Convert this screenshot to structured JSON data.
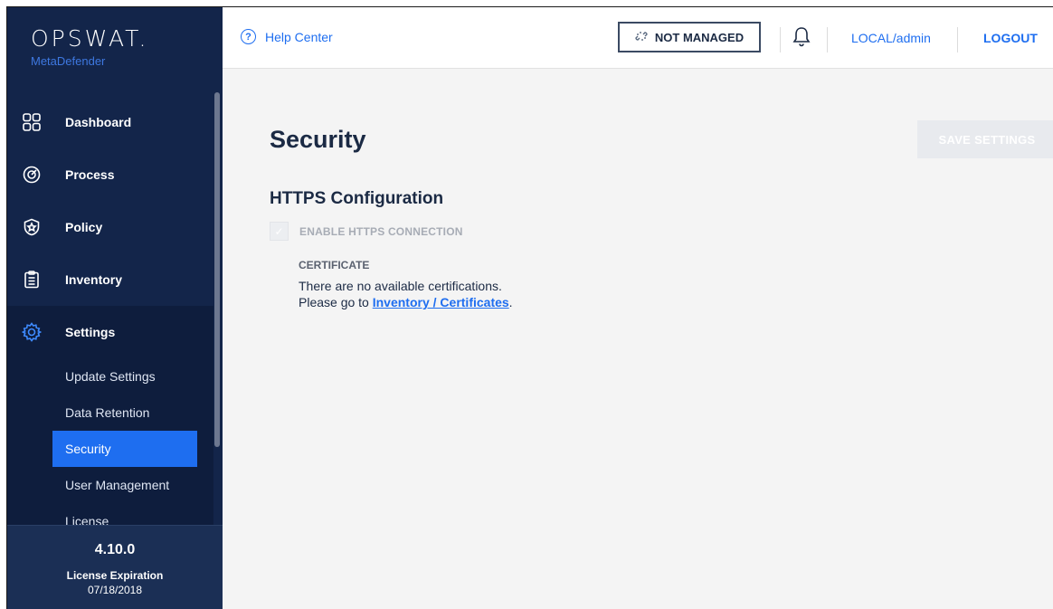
{
  "brand": {
    "name": "OPSWAT.",
    "product": "MetaDefender"
  },
  "nav": {
    "items": [
      {
        "label": "Dashboard",
        "icon": "dashboard-grid-icon"
      },
      {
        "label": "Process",
        "icon": "process-target-icon"
      },
      {
        "label": "Policy",
        "icon": "policy-shield-icon"
      },
      {
        "label": "Inventory",
        "icon": "inventory-clipboard-icon"
      },
      {
        "label": "Settings",
        "icon": "settings-gear-icon"
      }
    ],
    "settings_sub": [
      {
        "label": "Update Settings"
      },
      {
        "label": "Data Retention"
      },
      {
        "label": "Security"
      },
      {
        "label": "User Management"
      },
      {
        "label": "License"
      }
    ]
  },
  "footer": {
    "version": "4.10.0",
    "license_label": "License Expiration",
    "license_date": "07/18/2018"
  },
  "topbar": {
    "help": "Help Center",
    "not_managed": "NOT MANAGED",
    "user": "LOCAL/admin",
    "logout": "LOGOUT"
  },
  "page": {
    "title": "Security",
    "save_button": "SAVE SETTINGS",
    "section_title": "HTTPS Configuration",
    "https_checkbox_label": "ENABLE HTTPS CONNECTION",
    "certificate_label": "CERTIFICATE",
    "cert_line1": "There are no available certifications.",
    "cert_line2_prefix": "Please go to ",
    "cert_link": "Inventory / Certificates",
    "cert_line2_suffix": "."
  },
  "colors": {
    "sidebar": "#13254a",
    "accent": "#1e6ef0",
    "background": "#f4f4f4"
  }
}
